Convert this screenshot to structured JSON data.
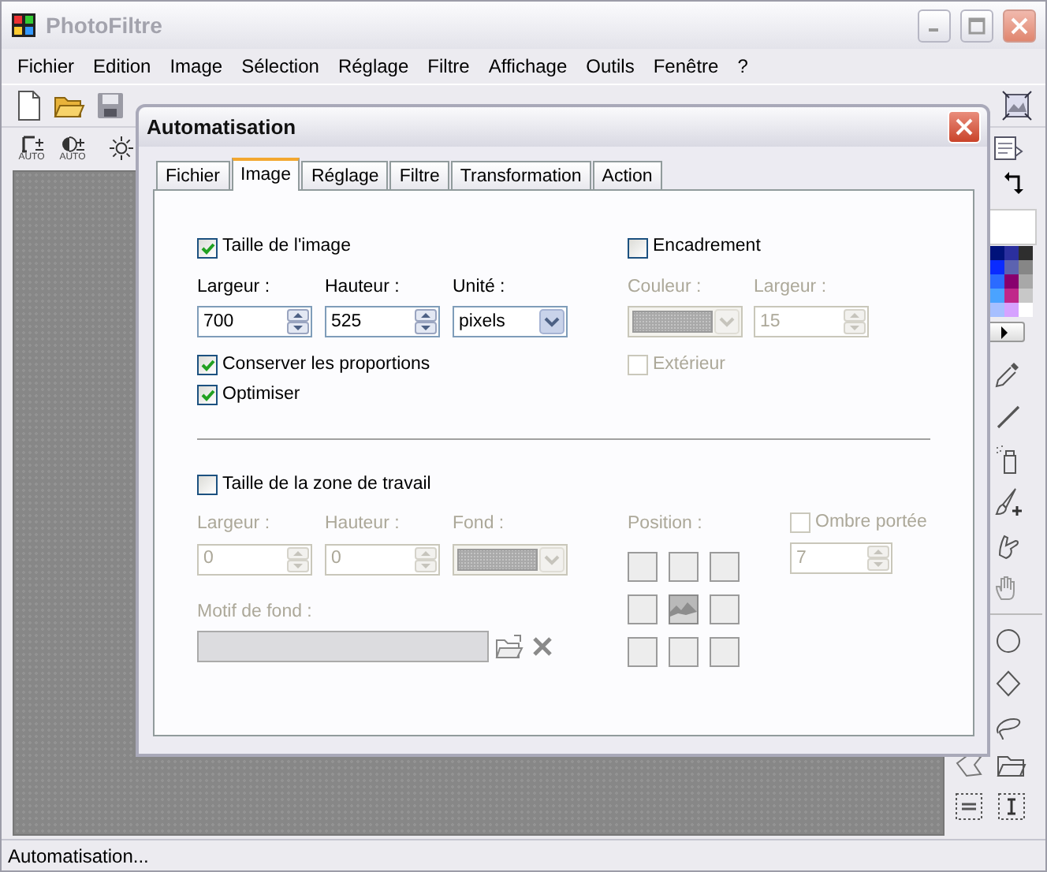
{
  "window": {
    "title": "PhotoFiltre"
  },
  "menu": [
    "Fichier",
    "Edition",
    "Image",
    "Sélection",
    "Réglage",
    "Filtre",
    "Affichage",
    "Outils",
    "Fenêtre",
    "?"
  ],
  "toolbar_captions": [
    "AUTO",
    "AUTO"
  ],
  "dialog": {
    "title": "Automatisation",
    "tabs": [
      {
        "label": "Fichier",
        "selected": false
      },
      {
        "label": "Image",
        "selected": true
      },
      {
        "label": "Réglage",
        "selected": false
      },
      {
        "label": "Filtre",
        "selected": false
      },
      {
        "label": "Transformation",
        "selected": false
      },
      {
        "label": "Action",
        "selected": false
      }
    ],
    "image_size": {
      "label": "Taille de l'image",
      "checked": true,
      "width": {
        "label": "Largeur :",
        "value": "700"
      },
      "height": {
        "label": "Hauteur :",
        "value": "525"
      },
      "unit": {
        "label": "Unité :",
        "value": "pixels"
      },
      "options": [
        {
          "label": "Conserver les proportions",
          "checked": true
        },
        {
          "label": "Optimiser",
          "checked": true
        }
      ]
    },
    "frame": {
      "label": "Encadrement",
      "checked": false,
      "color": {
        "label": "Couleur :"
      },
      "width": {
        "label": "Largeur :",
        "value": "15"
      },
      "outside": {
        "label": "Extérieur",
        "checked": false
      }
    },
    "canvas_size": {
      "label": "Taille de la zone de travail",
      "checked": false,
      "width": {
        "label": "Largeur :",
        "value": "0"
      },
      "height": {
        "label": "Hauteur :",
        "value": "0"
      },
      "background": {
        "label": "Fond :"
      },
      "pattern": {
        "label": "Motif de fond :"
      },
      "position": {
        "label": "Position :",
        "cells": [
          {
            "selected": false
          },
          {
            "selected": false
          },
          {
            "selected": false
          },
          {
            "selected": false
          },
          {
            "selected": true
          },
          {
            "selected": false
          },
          {
            "selected": false
          },
          {
            "selected": false
          },
          {
            "selected": false
          }
        ]
      },
      "shadow": {
        "label": "Ombre portée",
        "checked": false,
        "value": "7"
      }
    }
  },
  "status_bar": "Automatisation..."
}
